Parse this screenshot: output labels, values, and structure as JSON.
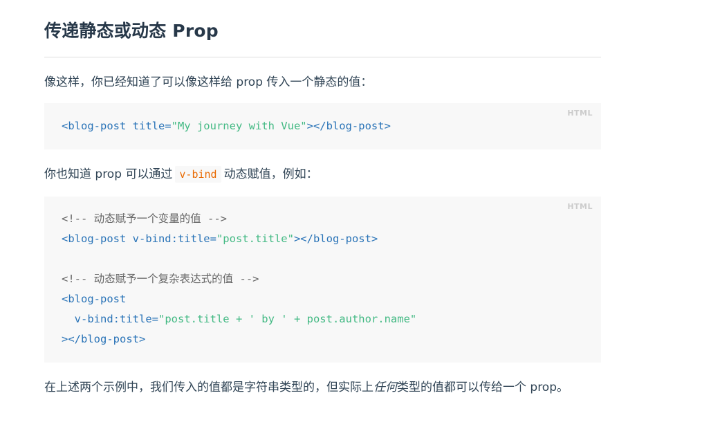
{
  "heading": "传递静态或动态 Prop",
  "para1": "像这样，你已经知道了可以像这样给 prop 传入一个静态的值：",
  "code1": {
    "lang": "HTML",
    "lines": [
      [
        {
          "t": "<blog-post title=",
          "c": "tag"
        },
        {
          "t": "\"My journey with Vue\"",
          "c": "str"
        },
        {
          "t": "></blog-post>",
          "c": "tag"
        }
      ]
    ]
  },
  "para2": {
    "before": "你也知道 prop 可以通过",
    "code": "v-bind",
    "after": "动态赋值，例如："
  },
  "code2": {
    "lang": "HTML",
    "lines": [
      [
        {
          "t": "<!-- 动态赋予一个变量的值 -->",
          "c": "cmt"
        }
      ],
      [
        {
          "t": "<blog-post v-bind:title=",
          "c": "tag"
        },
        {
          "t": "\"post.title\"",
          "c": "str"
        },
        {
          "t": "></blog-post>",
          "c": "tag"
        }
      ],
      [],
      [
        {
          "t": "<!-- 动态赋予一个复杂表达式的值 -->",
          "c": "cmt"
        }
      ],
      [
        {
          "t": "<blog-post",
          "c": "tag"
        }
      ],
      [
        {
          "t": "  v-bind:title=",
          "c": "tag"
        },
        {
          "t": "\"post.title + ' by ' + post.author.name\"",
          "c": "str"
        }
      ],
      [
        {
          "t": "></blog-post>",
          "c": "tag"
        }
      ]
    ]
  },
  "para3": {
    "before": "在上述两个示例中，我们传入的值都是字符串类型的，但实际上",
    "em": "任何",
    "after": "类型的值都可以传给一个 prop。"
  }
}
